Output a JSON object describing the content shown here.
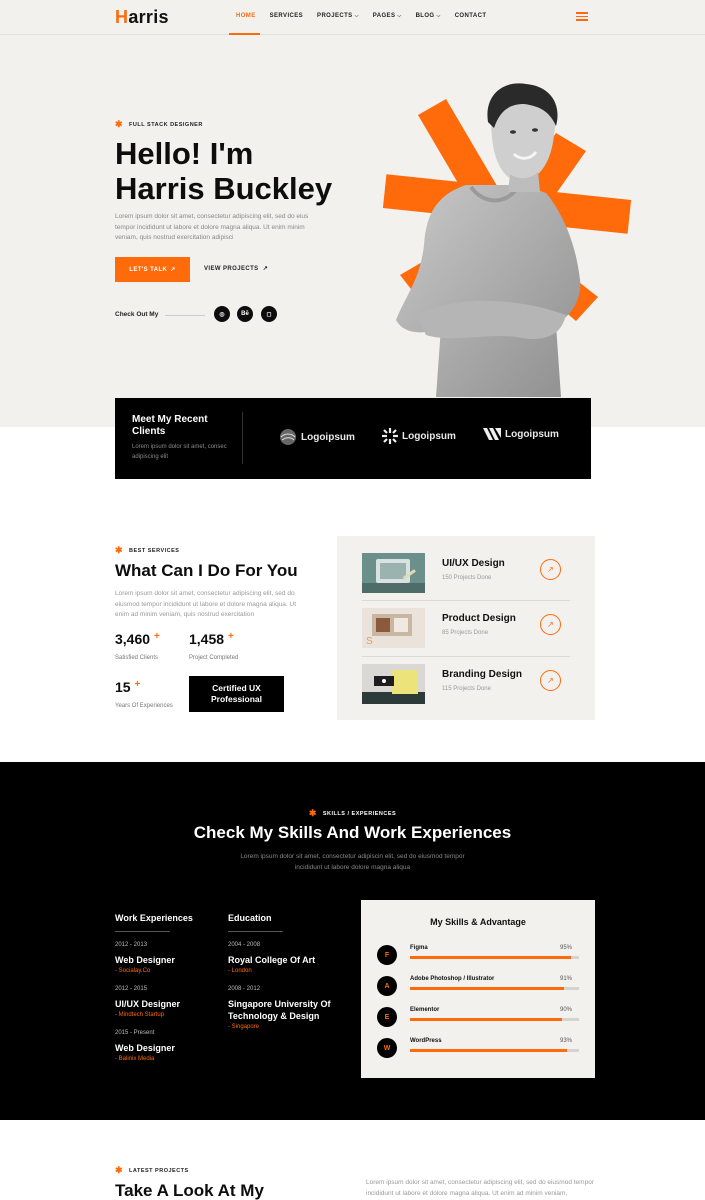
{
  "nav": {
    "logo_initial": "H",
    "logo_rest": "arris",
    "items": [
      {
        "label": "HOME",
        "dropdown": false,
        "active": true
      },
      {
        "label": "SERVICES",
        "dropdown": false,
        "active": false
      },
      {
        "label": "PROJECTS",
        "dropdown": true,
        "active": false
      },
      {
        "label": "PAGES",
        "dropdown": true,
        "active": false
      },
      {
        "label": "BLOG",
        "dropdown": true,
        "active": false
      },
      {
        "label": "CONTACT",
        "dropdown": false,
        "active": false
      }
    ],
    "accent": "#ff6a0a"
  },
  "hero": {
    "eyebrow": "FULL STACK DESIGNER",
    "title_line1": "Hello! I'm",
    "title_line2": "Harris Buckley",
    "description": "Lorem ipsum dolor sit amet, consectetur adipiscing elit, sed do eius tempor incididunt ut labore et dolore magna aliqua. Ut enim minim veniam, quis nostrud exercitation adipisci",
    "primary_button": "LET'S TALK",
    "secondary_button": "VIEW PROJECTS",
    "checkout_label": "Check Out My",
    "socials": [
      "dribbble-icon",
      "behance-icon",
      "instagram-icon"
    ],
    "social_glyphs": [
      "◎",
      "Bē",
      "◻"
    ]
  },
  "clients": {
    "title": "Meet My Recent Clients",
    "description": "Lorem ipsum dolor sit amet, consec adipiscing elit",
    "logos": [
      "Logoipsum",
      "Logoipsum",
      "Logoipsum"
    ]
  },
  "services": {
    "eyebrow": "BEST SERVICES",
    "title": "What Can I Do For You",
    "description": "Lorem ipsum dolor sit amet, consectetur adipiscing elit, sed do eiusmod tempor incididunt ut labore et dolore magna aliqua. Ut enim ad minim veniam, quis nostrud exercitation",
    "stats": [
      {
        "value": "3,460",
        "plus": "+",
        "label": "Satisfied Clients"
      },
      {
        "value": "1,458",
        "plus": "+",
        "label": "Project Completed"
      },
      {
        "value": "15",
        "plus": "+",
        "label": "Years Of Experiences"
      }
    ],
    "certified_line1": "Certified UX",
    "certified_line2": "Professional",
    "items": [
      {
        "name": "UI/UX Design",
        "count": "150 Projects Done"
      },
      {
        "name": "Product Design",
        "count": "85 Projects Done"
      },
      {
        "name": "Branding Design",
        "count": "115 Projects Done"
      }
    ]
  },
  "skills": {
    "eyebrow": "SKILLS / EXPERIENCES",
    "title": "Check My Skills And Work Experiences",
    "description": "Lorem ipsum dolor sit amet, consectetur adipiscin elit, sed do eiusmod tempor incididunt ut labore dolore magna aliqua",
    "work_heading": "Work Experiences",
    "education_heading": "Education",
    "work": [
      {
        "years": "2012 - 2013",
        "role": "Web Designer",
        "org": "- Socialay.Co"
      },
      {
        "years": "2012 - 2015",
        "role": "UI/UX Designer",
        "org": "- Mindtech Startup"
      },
      {
        "years": "2015 - Present",
        "role": "Web Designer",
        "org": "- Balinix Media"
      }
    ],
    "education": [
      {
        "years": "2004 - 2008",
        "school_line1": "Royal College Of Art",
        "school_line2": "",
        "place": "- London"
      },
      {
        "years": "2008 - 2012",
        "school_line1": "Singapore University Of",
        "school_line2": "Technology & Design",
        "place": "- Singapore"
      }
    ],
    "card_title": "My Skills & Advantage",
    "list": [
      {
        "name": "Figma",
        "percent": 95,
        "percent_label": "95%",
        "icon": "figma-icon",
        "glyph": "F"
      },
      {
        "name": "Adobe Photoshop / Illustrator",
        "percent": 91,
        "percent_label": "91%",
        "icon": "adobe-icon",
        "glyph": "A"
      },
      {
        "name": "Elementor",
        "percent": 90,
        "percent_label": "90%",
        "icon": "elementor-icon",
        "glyph": "E"
      },
      {
        "name": "WordPress",
        "percent": 93,
        "percent_label": "93%",
        "icon": "wordpress-icon",
        "glyph": "W"
      }
    ]
  },
  "projects": {
    "eyebrow": "LATEST PROJECTS",
    "title": "Take A Look At My",
    "description": "Lorem ipsum dolor sit amet, consectetur adipiscing elit, sed do eiusmod tempor incididunt ut labore et dolore magna aliqua. Ut enim ad minim veniam,"
  }
}
